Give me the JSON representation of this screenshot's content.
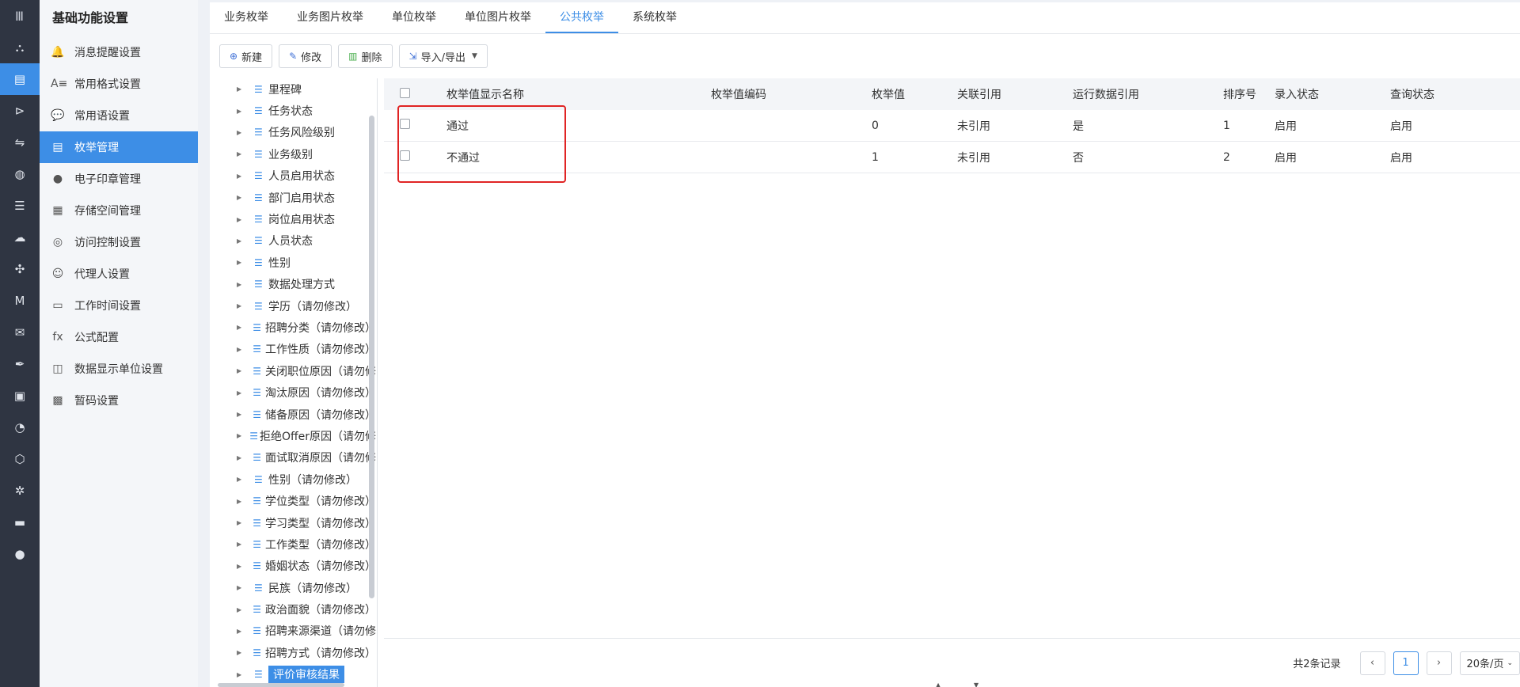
{
  "rail": {
    "top_icon": "Ⅲ",
    "items": [
      "⛬",
      "▤",
      "⊳",
      "⇋",
      "◍",
      "☰",
      "☁",
      "✣",
      "M",
      "✉",
      "✒",
      "▣",
      "◔",
      "⬡",
      "✲",
      "▬",
      "●"
    ]
  },
  "sidebar": {
    "title": "基础功能设置",
    "items": [
      {
        "label": "消息提醒设置",
        "icon": "🔔"
      },
      {
        "label": "常用格式设置",
        "icon": "A≡"
      },
      {
        "label": "常用语设置",
        "icon": "💬"
      },
      {
        "label": "枚举管理",
        "icon": "▤"
      },
      {
        "label": "电子印章管理",
        "icon": "●"
      },
      {
        "label": "存储空间管理",
        "icon": "▦"
      },
      {
        "label": "访问控制设置",
        "icon": "◎"
      },
      {
        "label": "代理人设置",
        "icon": "☺"
      },
      {
        "label": "工作时间设置",
        "icon": "▭"
      },
      {
        "label": "公式配置",
        "icon": "fx"
      },
      {
        "label": "数据显示单位设置",
        "icon": "◫"
      },
      {
        "label": "暂码设置",
        "icon": "▩"
      }
    ]
  },
  "tabs": [
    "业务枚举",
    "业务图片枚举",
    "单位枚举",
    "单位图片枚举",
    "公共枚举",
    "系统枚举"
  ],
  "toolbar": {
    "new": "新建",
    "edit": "修改",
    "delete": "删除",
    "import_export": "导入/导出"
  },
  "tree": [
    "里程碑",
    "任务状态",
    "任务风险级别",
    "业务级别",
    "人员启用状态",
    "部门启用状态",
    "岗位启用状态",
    "人员状态",
    "性别",
    "数据处理方式",
    "学历（请勿修改）",
    "招聘分类（请勿修改）",
    "工作性质（请勿修改）",
    "关闭职位原因（请勿修",
    "淘汰原因（请勿修改）",
    "储备原因（请勿修改）",
    "拒绝Offer原因（请勿修",
    "面试取消原因（请勿修",
    "性别（请勿修改）",
    "学位类型（请勿修改）",
    "学习类型（请勿修改）",
    "工作类型（请勿修改）",
    "婚姻状态（请勿修改）",
    "民族（请勿修改）",
    "政治面貌（请勿修改）",
    "招聘来源渠道（请勿修",
    "招聘方式（请勿修改）",
    "评价审核结果"
  ],
  "table": {
    "headers": [
      "枚举值显示名称",
      "枚举值编码",
      "枚举值",
      "关联引用",
      "运行数据引用",
      "排序号",
      "录入状态",
      "查询状态"
    ],
    "rows": [
      {
        "name": "通过",
        "code": "",
        "value": "0",
        "ref": "未引用",
        "runtime": "是",
        "order": "1",
        "input": "启用",
        "query": "启用"
      },
      {
        "name": "不通过",
        "code": "",
        "value": "1",
        "ref": "未引用",
        "runtime": "否",
        "order": "2",
        "input": "启用",
        "query": "启用"
      }
    ]
  },
  "pagination": {
    "total": "共2条记录",
    "prev": "‹",
    "current": "1",
    "next": "›",
    "page_size": "20条/页"
  }
}
